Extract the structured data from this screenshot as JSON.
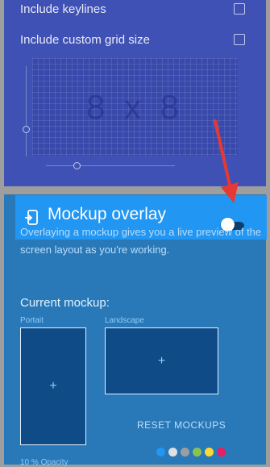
{
  "grid_card": {
    "keylines_label": "Include keylines",
    "custom_grid_label": "Include custom grid size",
    "grid_size_label": "8 x 8"
  },
  "overlay_card": {
    "title": "Mockup overlay",
    "description": "Overlaying a mockup gives you a live preview of the screen layout as you're working.",
    "current_mockup_title": "Current mockup:",
    "portrait_label": "Portait",
    "landscape_label": "Landscape",
    "add_symbol": "+",
    "reset_label": "RESET MOCKUPS",
    "opacity_label": "10 % Opacity",
    "toggle_on": true
  },
  "colors": {
    "grid_card_bg": "#3f51b5",
    "overlay_card_bg": "#2979b8",
    "header_bar_bg": "#2196f3",
    "arrow": "#e53935"
  },
  "watermark_dots": [
    "#2196f3",
    "#e0e0e0",
    "#9e9e9e",
    "#8bc34a",
    "#fdd835",
    "#e91e63"
  ]
}
